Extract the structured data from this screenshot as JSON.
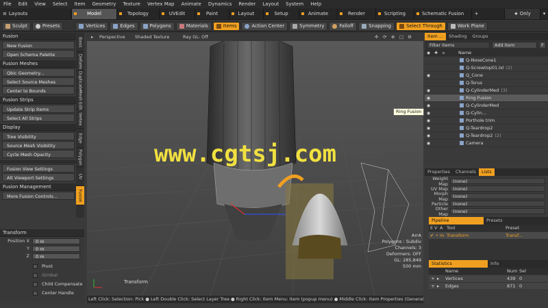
{
  "menubar": [
    "File",
    "Edit",
    "View",
    "Select",
    "Item",
    "Geometry",
    "Texture",
    "Vertex Map",
    "Animate",
    "Dynamics",
    "Render",
    "Layout",
    "System",
    "Help"
  ],
  "layouts_label": "Layouts",
  "top_tabs": [
    {
      "label": "Model",
      "active": true
    },
    {
      "label": "Topology",
      "active": false
    },
    {
      "label": "UVEdit",
      "active": false
    },
    {
      "label": "Paint",
      "active": false
    },
    {
      "label": "Layout",
      "active": false
    },
    {
      "label": "Setup",
      "active": false
    },
    {
      "label": "Animate",
      "active": false
    },
    {
      "label": "Render",
      "active": false
    },
    {
      "label": "Scripting",
      "active": false
    },
    {
      "label": "Schematic Fusion",
      "active": false
    }
  ],
  "add_tab_label": "+",
  "only_label": "★ Only",
  "toolbar": {
    "sculpt": "Sculpt",
    "presets": "Presets",
    "vertices": "Vertices",
    "edges": "Edges",
    "polygons": "Polygons",
    "materials": "Materials",
    "items": "Items",
    "action_center": "Action Center",
    "symmetry": "Symmetry",
    "falloff": "Falloff",
    "snapping": "Snapping",
    "select_through": "Select Through",
    "work_plane": "Work Plane"
  },
  "left_panel": {
    "sections": [
      {
        "title": "Fusion",
        "items": [
          "New Fusion",
          "Open Schema Palette"
        ]
      },
      {
        "title": "Fusion Meshes",
        "items": [
          "Qbic Geometry...",
          "Select Source Meshes",
          "Center to Bounds"
        ]
      },
      {
        "title": "Fusion Strips",
        "items": [
          "Update Strip Items",
          "Select All Strips"
        ]
      },
      {
        "title": "Display",
        "items": [
          "Tree Visibility",
          "Source Mesh Visibility",
          "Cycle Mesh Opacity"
        ]
      },
      {
        "title": "",
        "items": [
          "Fusion View Settings",
          "Alt Viewport Settings"
        ]
      },
      {
        "title": "Fusion Management",
        "items": [
          "More Fusion Controls..."
        ]
      }
    ]
  },
  "vertical_tabs": [
    "Basic",
    "Deform",
    "Duplicate",
    "Mesh Edit",
    "Vertex",
    "Edge",
    "Polygon",
    "UV",
    "Fusion"
  ],
  "transform": {
    "title": "Transform",
    "position_label": "Position X",
    "y_label": "Y",
    "z_label": "Z",
    "x": "0 m",
    "y": "0 m",
    "z": "0 m",
    "checks": [
      "Pivot",
      "Gimbal",
      "Child Compensate",
      "Center Handle"
    ]
  },
  "viewport": {
    "view": "Perspective",
    "shading": "Shaded Texture",
    "raygl": "Ray GL: Off",
    "corner_label": "Transform",
    "info": [
      "ArrA",
      "Polygons : Subdiv",
      "Channels: 3",
      "Deformers: OFF",
      "GL: 285,849",
      "500 mm"
    ],
    "tooltip": "Ring Fusion"
  },
  "statusbar": "Left Click: Selection: Pick ● Left Double Click: Select Layer Tree ● Right Click: Item Menu: Item (popup menu) ● Middle Click: Item Properties (General) (popover)",
  "watermark": "www.cgtsj.com",
  "right_panel": {
    "tabs": [
      "Item ...",
      "Shading",
      "Groups"
    ],
    "filter_label": "Filter Items",
    "add_item": "Add Item",
    "f_label": "F",
    "name_header": "Name",
    "items": [
      {
        "name": "Q-NoseCone1",
        "count": "",
        "eye": ""
      },
      {
        "name": "Q-Screwtop01.lxl",
        "count": "(2)",
        "eye": ""
      },
      {
        "name": "Q_Cone",
        "count": "",
        "eye": "◉"
      },
      {
        "name": "Q-Torus",
        "count": "",
        "eye": ""
      },
      {
        "name": "Q-CylinderMed",
        "count": "(3)",
        "eye": "◉"
      },
      {
        "name": "Ring Fusion",
        "count": "",
        "eye": "◉"
      },
      {
        "name": "Q-CylinderMed",
        "count": "",
        "eye": "◉"
      },
      {
        "name": "Q-Cylin...",
        "count": "",
        "eye": "◉"
      },
      {
        "name": "Porthole trim",
        "count": "",
        "eye": "◉"
      },
      {
        "name": "Q-Teardrop2",
        "count": "",
        "eye": "◉"
      },
      {
        "name": "Q-Teardrop2",
        "count": "(2)",
        "eye": "◉"
      },
      {
        "name": "Camera",
        "count": "",
        "eye": "◉"
      }
    ],
    "prop_tabs": [
      "Properties",
      "Channels",
      "Lists"
    ],
    "lists": [
      {
        "label": "Weight Map",
        "value": "(none)"
      },
      {
        "label": "UV Map",
        "value": "(none)"
      },
      {
        "label": "Morph Map",
        "value": "(none)"
      },
      {
        "label": "Particle",
        "value": "(none)"
      },
      {
        "label": "Other Map",
        "value": "(none)"
      }
    ],
    "pipeline_tabs": [
      "Pipeline",
      "Presets"
    ],
    "pipeline_headers": [
      "E",
      "V",
      "A",
      "Tool",
      "Preset"
    ],
    "pipeline_row": {
      "tool": "Transform",
      "preset": "Transf..."
    },
    "stats_tabs": [
      "Statistics",
      "Info"
    ],
    "stats_headers": [
      "Name",
      "Num",
      "Sel"
    ],
    "stats": [
      {
        "name": "Vertices",
        "num": "439",
        "sel": "0"
      },
      {
        "name": "Edges",
        "num": "871",
        "sel": "0"
      }
    ]
  },
  "colors": {
    "accent": "#f0a020",
    "watermark": "#f0e040"
  }
}
